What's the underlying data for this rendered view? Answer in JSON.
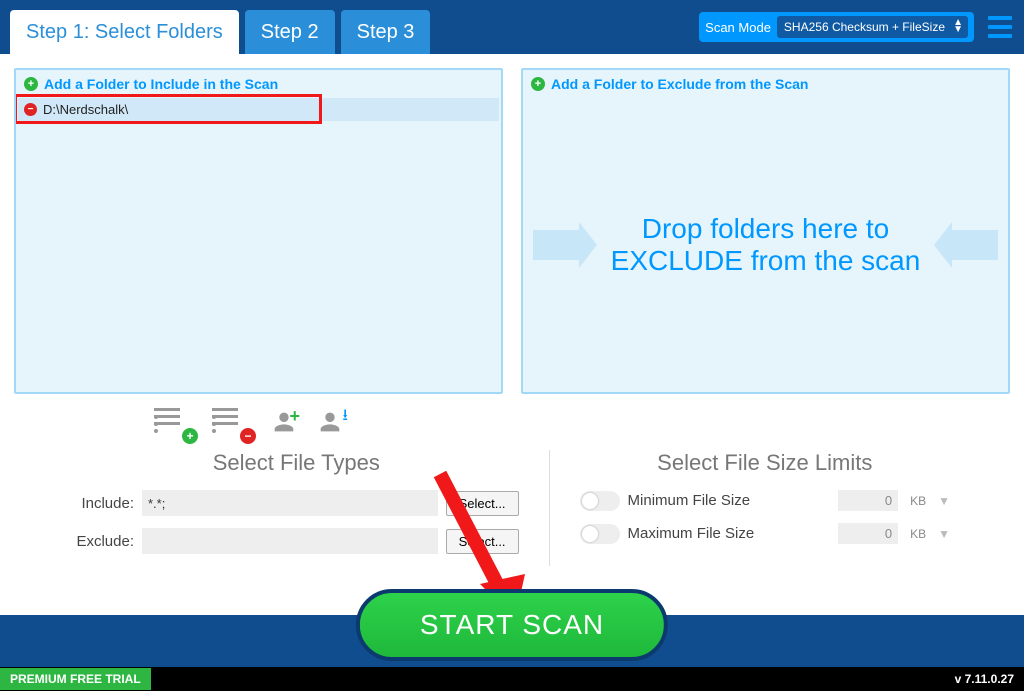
{
  "tabs": {
    "step1": "Step 1: Select Folders",
    "step2": "Step 2",
    "step3": "Step 3"
  },
  "scanMode": {
    "label": "Scan Mode",
    "value": "SHA256 Checksum + FileSize"
  },
  "includePanel": {
    "addLabel": "Add a Folder to Include in the Scan",
    "folders": [
      "D:\\Nerdschalk\\"
    ]
  },
  "excludePanel": {
    "addLabel": "Add a Folder to Exclude from the Scan",
    "dropText": "Drop folders here to EXCLUDE from the scan"
  },
  "fileTypes": {
    "title": "Select File Types",
    "includeLabel": "Include:",
    "includeValue": "*.*;",
    "excludeLabel": "Exclude:",
    "excludeValue": "",
    "selectBtn": "Select..."
  },
  "sizeLimits": {
    "title": "Select File Size Limits",
    "minLabel": "Minimum File Size",
    "minValue": "0",
    "maxLabel": "Maximum File Size",
    "maxValue": "0",
    "unit": "KB"
  },
  "startScan": "START SCAN",
  "footer": {
    "trial": "PREMIUM FREE TRIAL",
    "version": "v 7.11.0.27"
  }
}
